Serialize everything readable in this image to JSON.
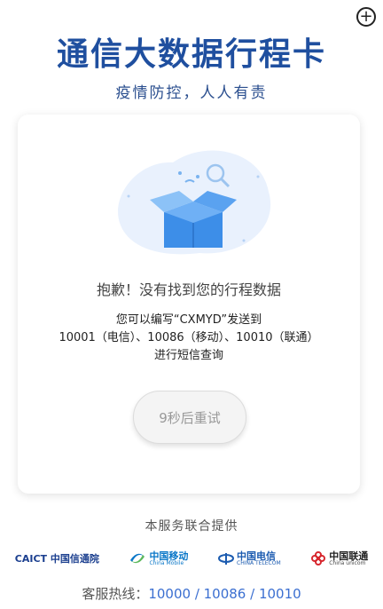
{
  "header": {
    "title": "通信大数据行程卡",
    "subtitle": "疫情防控，人人有责"
  },
  "card": {
    "error_message": "抱歉！没有找到您的行程数据",
    "hint_line1": "您可以编写“CXMYD”发送到",
    "hint_line2": "10001（电信）、10086（移动）、10010（联通）",
    "hint_line3": "进行短信查询",
    "retry_label": "9秒后重试"
  },
  "footer": {
    "title": "本服务联合提供",
    "logos": [
      {
        "name": "CAICT 中国信通院"
      },
      {
        "name": "中国移动",
        "sub": "China Mobile"
      },
      {
        "name": "中国电信",
        "sub": "CHINA TELECOM"
      },
      {
        "name": "中国联通",
        "sub": "China unicom"
      }
    ],
    "hotline_label": "客服热线：",
    "hotline_numbers": "10000 / 10086 / 10010"
  },
  "colors": {
    "brand_blue": "#1f4f9f",
    "accent_blue": "#3b6fd1",
    "unicom_red": "#d7282f",
    "telecom_blue": "#1b5bb0",
    "mobile_blue": "#0a77c8"
  },
  "icons": [
    "plus-icon",
    "empty-box-icon",
    "magnifier-icon"
  ]
}
